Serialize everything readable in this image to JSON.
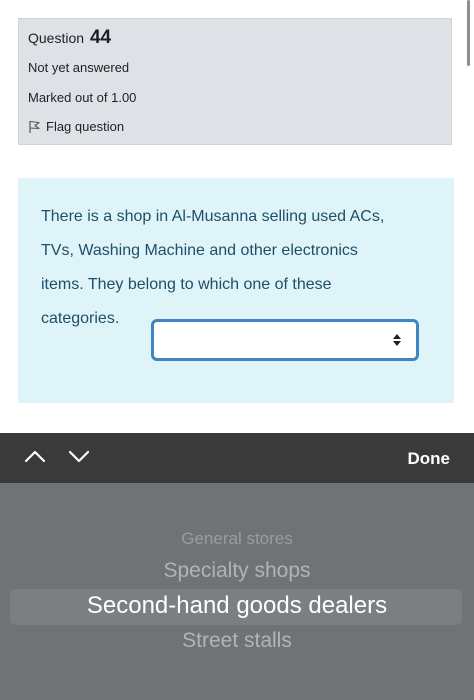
{
  "info": {
    "question_label": "Question",
    "question_number": "44",
    "state": "Not yet answered",
    "grade": "Marked out of 1.00",
    "flag_label": "Flag question",
    "flag_icon": "flag-outline-icon"
  },
  "question": {
    "line1": "There is a shop in Al-Musanna selling used ACs,",
    "line2": "TVs, Washing Machine and other electronics",
    "line3": "items. They belong to which one of these",
    "line4": "categories.",
    "selected_value": "",
    "select_icon": "sort-arrows-icon"
  },
  "toolbar": {
    "prev_icon": "chevron-up-icon",
    "next_icon": "chevron-down-icon",
    "done_label": "Done"
  },
  "picker": {
    "options": [
      "General stores",
      "Specialty shops",
      "Second-hand goods dealers",
      "Street stalls"
    ],
    "highlighted": "Second-hand goods dealers"
  },
  "colors": {
    "info_bg": "#dee2e6",
    "question_bg": "#dff4f9",
    "question_text": "#1f4f66",
    "select_border": "#3c86c4",
    "toolbar_bg": "#3a3a3a",
    "picker_bg": "#6f7375"
  }
}
